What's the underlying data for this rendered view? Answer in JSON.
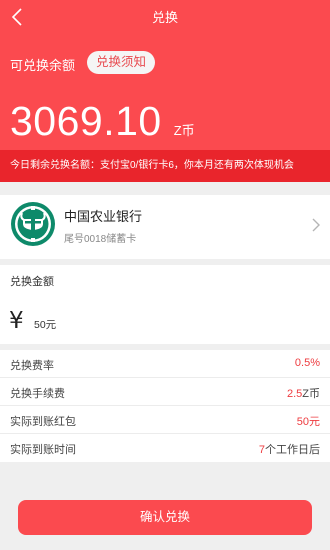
{
  "nav": {
    "title": "兑换",
    "back_icon": "chevron-left-icon"
  },
  "balance": {
    "label": "可兑换余额",
    "notice_button": "兑换须知",
    "value": "3069.10",
    "unit": "Z币"
  },
  "info_bar": {
    "text": "今日剩余兑换名额：支付宝0/银行卡6，你本月还有两次体现机会"
  },
  "bank_card": {
    "logo_icon": "agricultural-bank-logo-icon",
    "name": "中国农业银行",
    "sub": "尾号0018储蓄卡",
    "arrow_icon": "chevron-right-icon"
  },
  "amount": {
    "label": "兑换金额",
    "currency_symbol": "¥",
    "value": "50元"
  },
  "details": [
    {
      "label": "兑换费率",
      "value_highlight": "0.5",
      "value_suffix": "%"
    },
    {
      "label": "兑换手续费",
      "value_highlight": "2.5",
      "value_suffix": "Z币"
    },
    {
      "label": "实际到账红包",
      "value_highlight": "50元",
      "value_suffix": ""
    },
    {
      "label": "实际到账时间",
      "value_highlight": "7",
      "value_suffix": "个工作日后"
    }
  ],
  "confirm_button": "确认兑换",
  "colors": {
    "primary": "#fb4a4f",
    "info_bar": "#e9252c",
    "bank_green": "#0e8a6a",
    "highlight": "#ee3b3f"
  }
}
